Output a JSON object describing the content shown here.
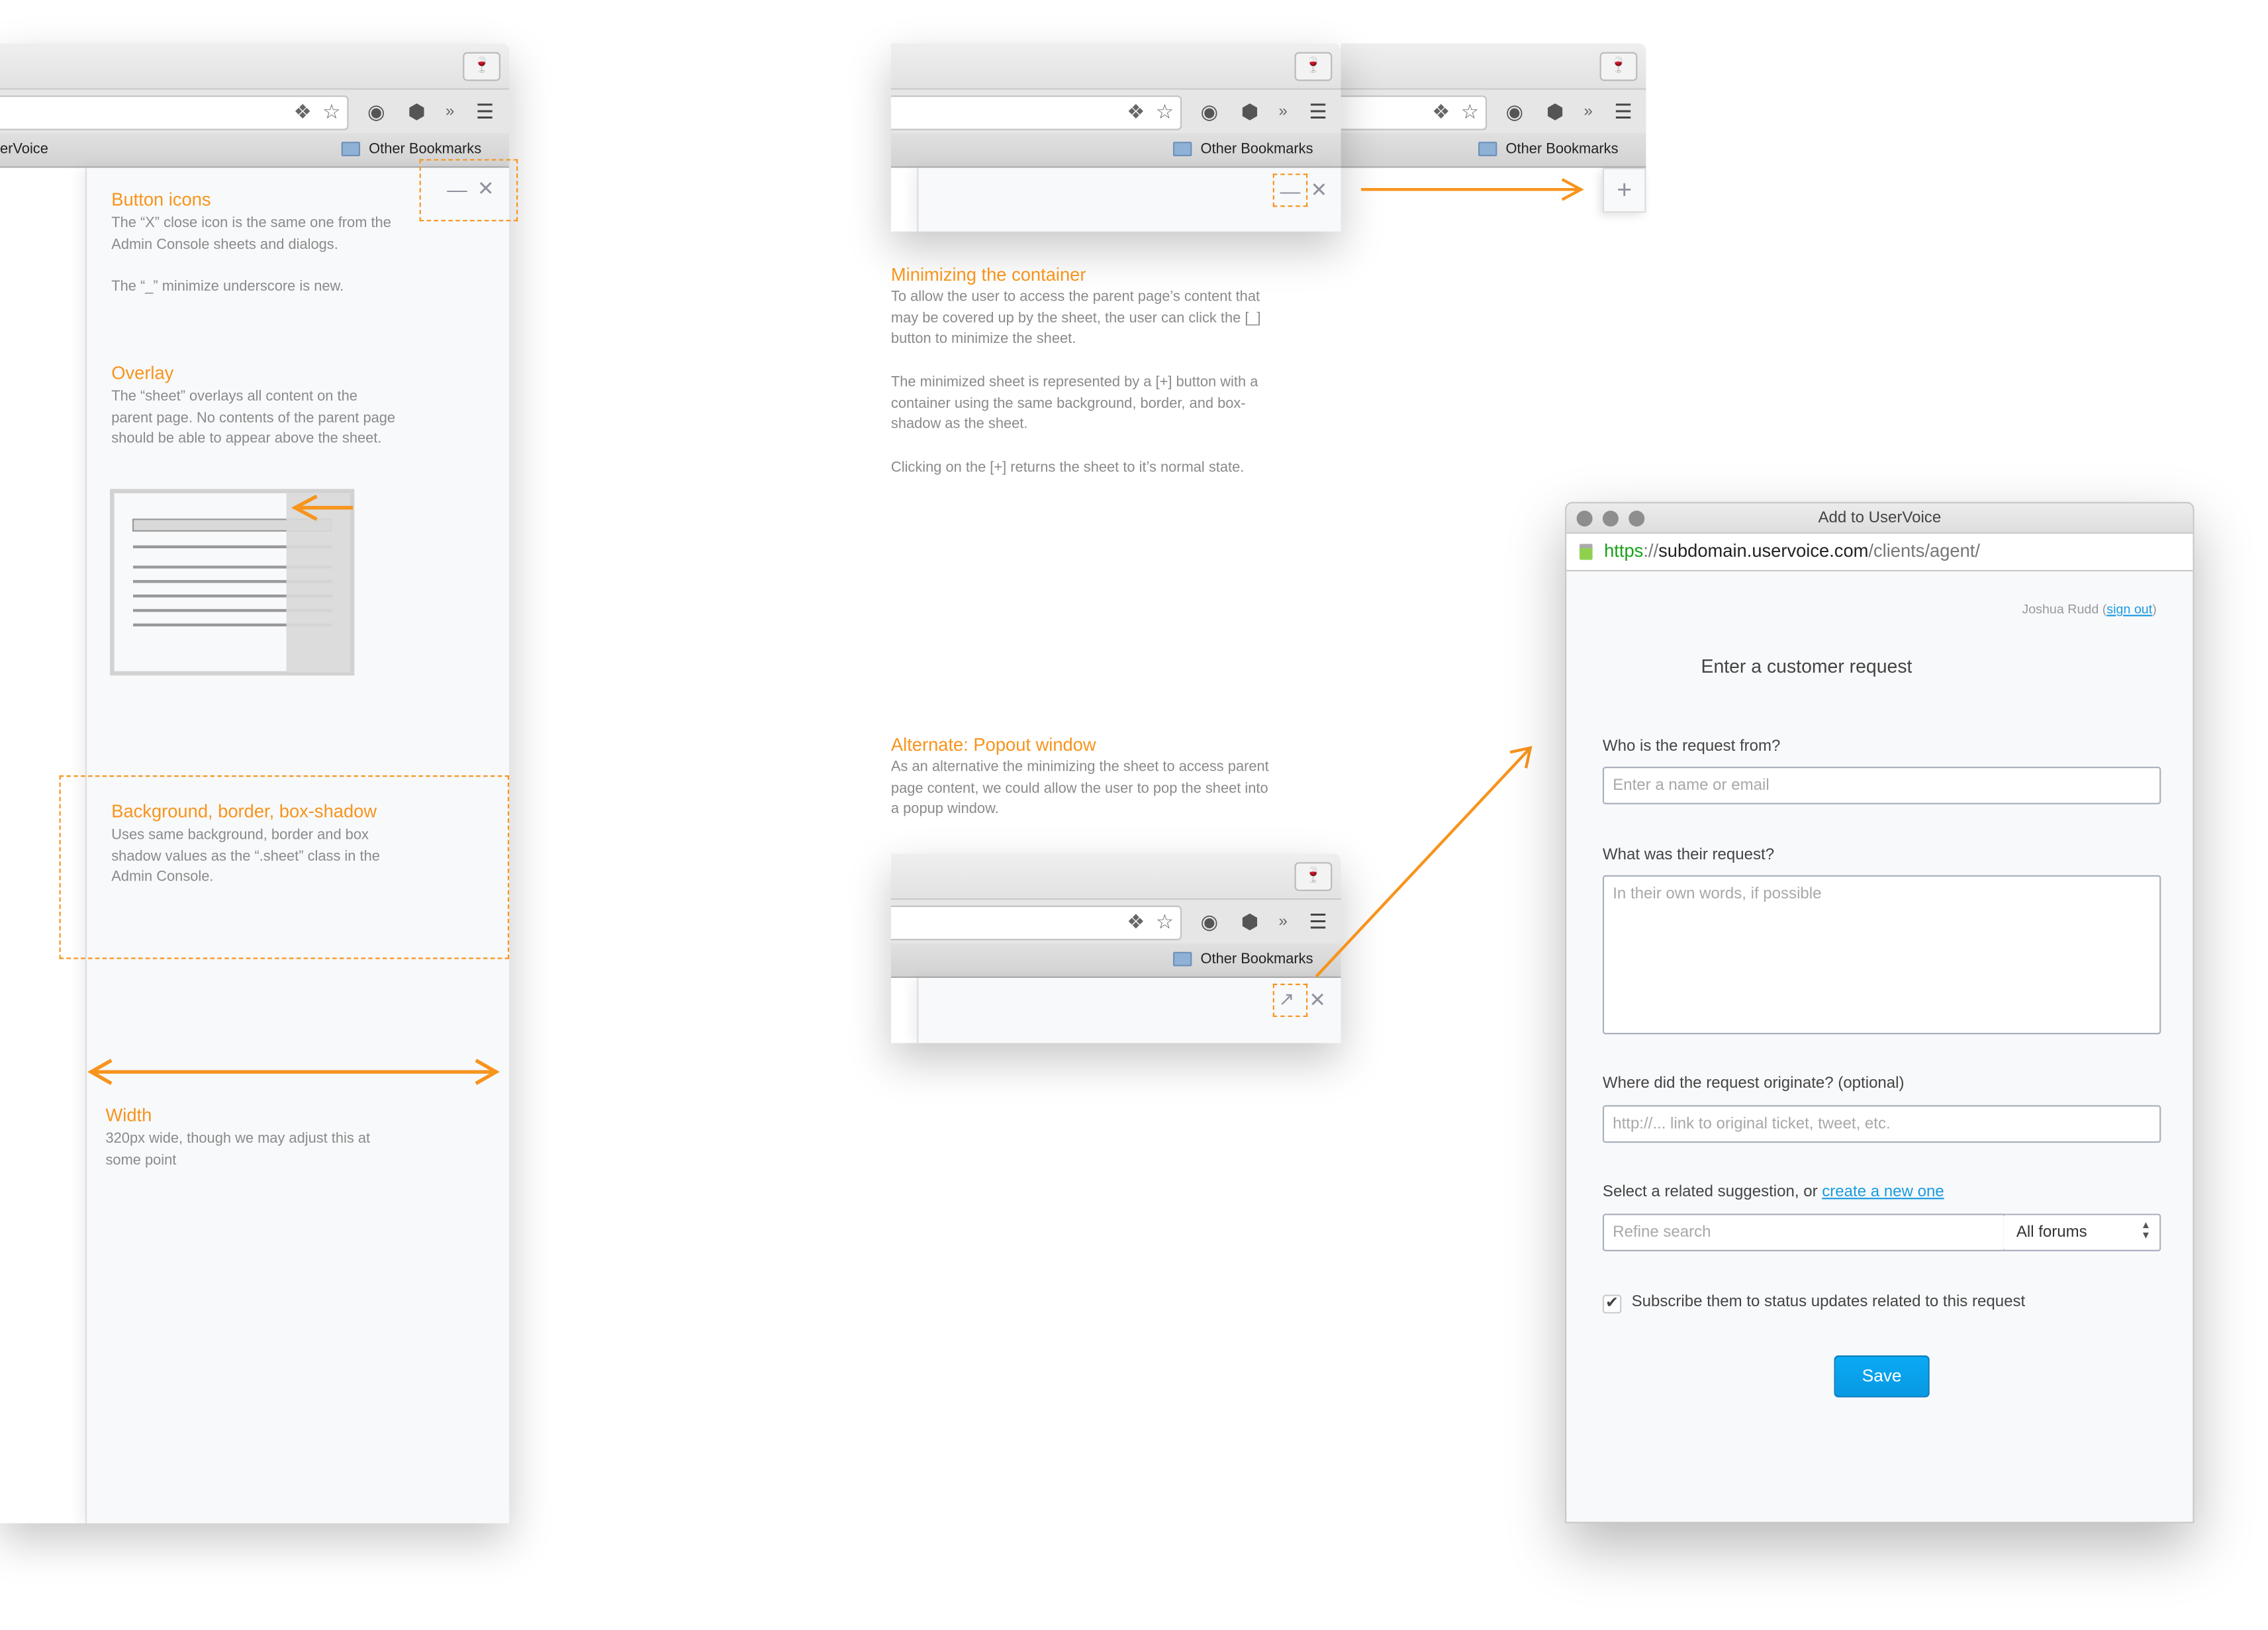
{
  "browser": {
    "bookmark_partial": "erVoice",
    "other_bookmarks": "Other Bookmarks",
    "icons": [
      "wine-glass-icon",
      "diamond-extension-icon",
      "star-icon",
      "evernote-icon",
      "hex-extension-icon",
      "overflow-chevron-icon",
      "menu-icon",
      "folder-icon"
    ]
  },
  "sheet_notes": {
    "button_icons": {
      "title": "Button icons",
      "body1": "The “X” close icon is the same one from the Admin Console sheets and dialogs.",
      "body2": "The “_” minimize underscore is new."
    },
    "overlay": {
      "title": "Overlay",
      "body": "The “sheet” overlays all content on the parent page. No contents of the parent page should be able to appear above the sheet."
    },
    "background": {
      "title": "Background, border, box-shadow",
      "body": "Uses same background, border and box shadow values as the “.sheet” class in the Admin Console."
    },
    "width": {
      "title": "Width",
      "body": "320px wide, though we may adjust this at some point"
    }
  },
  "minimizing": {
    "title": "Minimizing the container",
    "body1": "To allow the user to access the parent page’s content that may be covered up by the sheet, the user can click the [_] button to minimize the sheet.",
    "body2": "The minimized sheet is represented by a [+] button with a container using the same background, border, and box-shadow as the sheet.",
    "body3": "Clicking on the [+] returns the sheet to it’s normal state."
  },
  "popout": {
    "title": "Alternate: Popout window",
    "body": "As an alternative the minimizing the sheet to access parent page content, we could allow the user to pop the sheet into a popup window."
  },
  "accent_color": "#f7941d",
  "popup": {
    "window_title": "Add to UserVoice",
    "url": {
      "scheme": "https",
      "sep": "://",
      "host": "subdomain.uservoice.com",
      "path": "/clients/agent/"
    },
    "user_name": "Joshua Rudd",
    "sign_out": "sign out",
    "heading": "Enter a customer request",
    "from_label": "Who is the request from?",
    "from_placeholder": "Enter a name or email",
    "request_label": "What was their request?",
    "request_placeholder": "In their own words, if possible",
    "origin_label": "Where did the request originate? (optional)",
    "origin_placeholder": "http://... link to original ticket, tweet, etc.",
    "suggestion_label": "Select a related suggestion, or",
    "create_link": "create a new one",
    "refine_placeholder": "Refine search",
    "forum_select": "All forums",
    "subscribe_label": "Subscribe them to status updates related to this request",
    "subscribe_checked": true,
    "save": "Save",
    "link_color": "#1a9be0",
    "button_color": "#0aa3ef"
  }
}
